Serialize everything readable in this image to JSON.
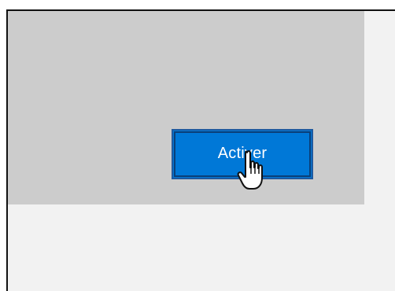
{
  "window": {
    "activate_button_label": "Activer"
  },
  "icons": {
    "cursor": "pointing-hand-cursor-icon"
  },
  "colors": {
    "button_background": "#0078d7",
    "button_border": "#1e5aa0",
    "panel_background": "#cccccc",
    "window_background": "#f2f2f2"
  }
}
